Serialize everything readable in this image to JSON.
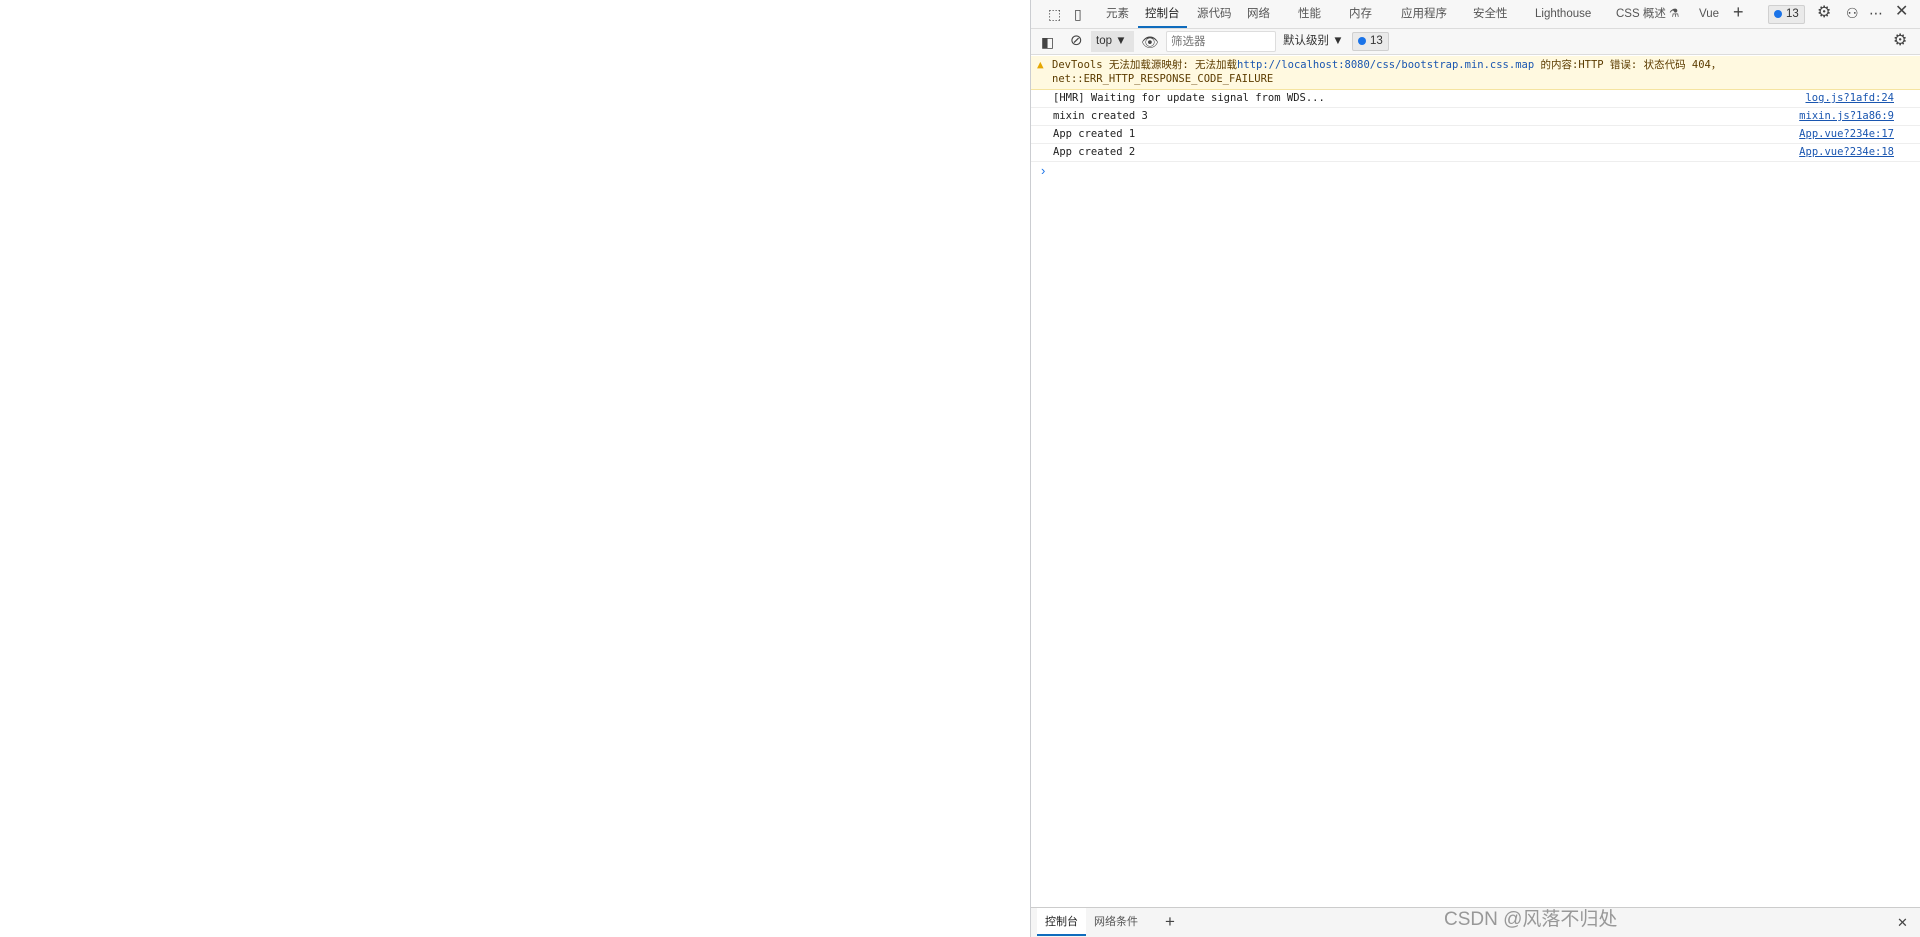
{
  "devtools": {
    "tabs": [
      "元素",
      "控制台",
      "源代码",
      "网络",
      "性能",
      "内存",
      "应用程序",
      "安全性",
      "Lighthouse",
      "CSS 概述 ⚗",
      "Vue"
    ],
    "active_tab": "控制台",
    "issues_count": "13",
    "toolbar": {
      "context": "top",
      "filter_placeholder": "筛选器",
      "level": "默认级别",
      "issues_count": "13"
    },
    "console": {
      "warning": {
        "prefix": "DevTools 无法加载源映射: 无法加载",
        "url": "http://localhost:8080/css/bootstrap.min.css.map",
        "suffix": " 的内容:HTTP 错误: 状态代码 404，",
        "line2": "net::ERR_HTTP_RESPONSE_CODE_FAILURE"
      },
      "messages": [
        {
          "text": "[HMR] Waiting for update signal from WDS...",
          "source": "log.js?1afd:24"
        },
        {
          "text": "mixin created  3",
          "source": "mixin.js?1a86:9"
        },
        {
          "text": "App created  1",
          "source": "App.vue?234e:17"
        },
        {
          "text": "App created  2",
          "source": "App.vue?234e:18"
        }
      ],
      "prompt": "›"
    },
    "drawer": {
      "tabs": [
        "控制台",
        "网络条件"
      ],
      "active": "控制台"
    }
  },
  "watermark": "CSDN @风落不归处"
}
